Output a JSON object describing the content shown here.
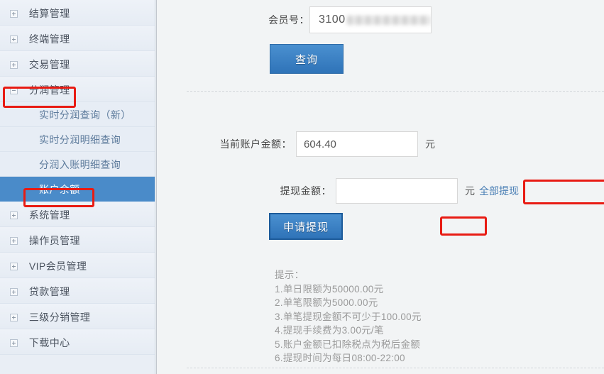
{
  "sidebar": {
    "items": [
      {
        "label": "结算管理",
        "type": "top",
        "icon": "plus-square-icon",
        "selected": false
      },
      {
        "label": "终端管理",
        "type": "top",
        "icon": "plus-square-icon",
        "selected": false
      },
      {
        "label": "交易管理",
        "type": "top",
        "icon": "plus-square-icon",
        "selected": false
      },
      {
        "label": "分润管理",
        "type": "top",
        "icon": "minus-square-icon",
        "selected": false,
        "highlighted": true
      },
      {
        "label": "实时分润查询（新）",
        "type": "sub",
        "selected": false
      },
      {
        "label": "实时分润明细查询",
        "type": "sub",
        "selected": false
      },
      {
        "label": "分润入账明细查询",
        "type": "sub",
        "selected": false
      },
      {
        "label": "账户余额",
        "type": "sub",
        "selected": true,
        "highlighted": true
      },
      {
        "label": "系统管理",
        "type": "top",
        "icon": "plus-square-icon",
        "selected": false
      },
      {
        "label": "操作员管理",
        "type": "top",
        "icon": "plus-square-icon",
        "selected": false
      },
      {
        "label": "VIP会员管理",
        "type": "top",
        "icon": "plus-square-icon",
        "selected": false
      },
      {
        "label": "贷款管理",
        "type": "top",
        "icon": "plus-square-icon",
        "selected": false
      },
      {
        "label": "三级分销管理",
        "type": "top",
        "icon": "plus-square-icon",
        "selected": false
      },
      {
        "label": "下载中心",
        "type": "top",
        "icon": "plus-square-icon",
        "selected": false
      }
    ]
  },
  "main": {
    "member": {
      "label": "会员号：",
      "value": "3100",
      "masked": true
    },
    "query_button": "查询",
    "balance": {
      "label": "当前账户金额：",
      "value": "604.40",
      "unit": "元"
    },
    "withdraw": {
      "label": "提现金额：",
      "value": "",
      "placeholder": "",
      "unit": "元",
      "all_link": "全部提现"
    },
    "apply_button": "申请提现",
    "tips": {
      "title": "提示：",
      "lines": [
        "1.单日限额为50000.00元",
        "2.单笔限额为5000.00元",
        "3.单笔提现金额不可少于100.00元",
        "4.提现手续费为3.00元/笔",
        "5.账户金额已扣除税点为税后金额",
        "6.提现时间为每日08:00-22:00"
      ]
    }
  },
  "colors": {
    "accent_blue": "#4a8bc9",
    "button_blue": "#2f73b8",
    "annotation_red": "#e81b13",
    "sidebar_bg": "#e9eef5",
    "content_bg": "#f2f4f5",
    "link_blue": "#4a7fb5"
  }
}
